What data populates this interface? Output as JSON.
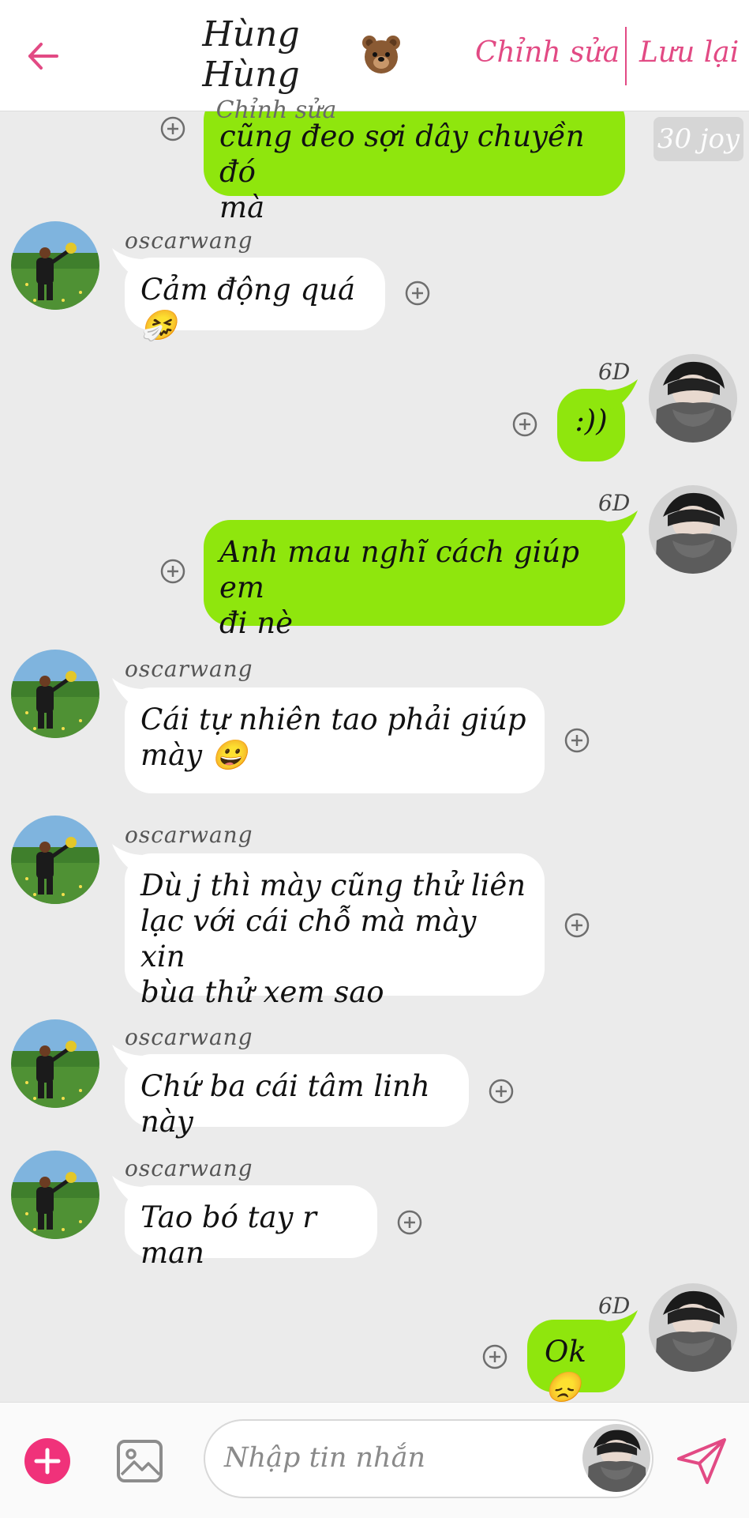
{
  "header": {
    "title": "Hùng Hùng",
    "subtitle": "Chỉnh sửa",
    "edit_label": "Chỉnh sửa",
    "save_label": "Lưu lại"
  },
  "joy_badge": "30 joy",
  "messages": [
    {
      "side": "right",
      "text_lines": [
        "cũng đeo sợi dây chuyền đó",
        "mà"
      ]
    },
    {
      "side": "left",
      "name": "oscarwang",
      "text_lines": [
        "Cảm động quá 🤧"
      ]
    },
    {
      "side": "right",
      "tag": "6D",
      "text_lines": [
        ":))"
      ]
    },
    {
      "side": "right",
      "tag": "6D",
      "text_lines": [
        "Anh mau nghĩ cách giúp em",
        "đi nè"
      ]
    },
    {
      "side": "left",
      "name": "oscarwang",
      "text_lines": [
        "Cái tự nhiên tao phải giúp",
        "mày 😀"
      ]
    },
    {
      "side": "left",
      "name": "oscarwang",
      "text_lines": [
        "Dù j thì mày cũng thử liên",
        "lạc với cái chỗ mà mày xin",
        "bùa thử xem sao"
      ]
    },
    {
      "side": "left",
      "name": "oscarwang",
      "text_lines": [
        "Chứ ba cái tâm linh này"
      ]
    },
    {
      "side": "left",
      "name": "oscarwang",
      "text_lines": [
        "Tao bó tay r man"
      ]
    },
    {
      "side": "right",
      "tag": "6D",
      "text_lines": [
        "Ok😞"
      ]
    }
  ],
  "input": {
    "placeholder": "Nhập tin nhắn"
  },
  "colors": {
    "accent": "#e24a84",
    "sent_bubble": "#8fe60d",
    "received_bubble": "#ffffff",
    "background": "#ebebeb"
  }
}
